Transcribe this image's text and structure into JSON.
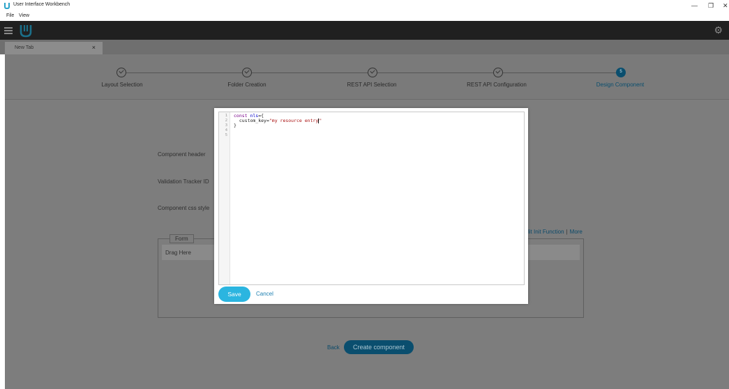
{
  "window": {
    "title": "User Interface Workbench",
    "minimize": "—",
    "restore": "❐",
    "close": "✕",
    "menu": [
      "File",
      "View"
    ]
  },
  "header": {
    "settings_icon": "gear-icon",
    "gear_glyph": "⚙"
  },
  "tabs": [
    {
      "label": "New Tab",
      "close": "×"
    }
  ],
  "stepper": {
    "steps": [
      {
        "label": "Layout Selection",
        "state": "done"
      },
      {
        "label": "Folder Creation",
        "state": "done"
      },
      {
        "label": "REST API Selection",
        "state": "done"
      },
      {
        "label": "REST API Configuration",
        "state": "done"
      },
      {
        "label": "Design Component",
        "state": "active",
        "number": "5"
      }
    ]
  },
  "form": {
    "component_header_label": "Component header",
    "validation_tracker_label": "Validation Tracker ID",
    "css_style_label": "Component css style",
    "init_function_link": "lit Init Function",
    "separator": "|",
    "more_link": "More",
    "panel_legend": "Form",
    "drag_label": "Drag Here"
  },
  "footer": {
    "back_label": "Back",
    "create_label": "Create component"
  },
  "modal": {
    "code_lines": [
      {
        "num": "1",
        "parts": [
          [
            "kw",
            "const "
          ],
          [
            "var",
            "nls"
          ],
          [
            "plain",
            "={"
          ]
        ]
      },
      {
        "num": "2",
        "parts": [
          [
            "plain",
            "  custom_key="
          ],
          [
            "str",
            "\"my resource entry"
          ],
          [
            "cursor",
            ""
          ],
          [
            "str",
            "\""
          ]
        ]
      },
      {
        "num": "3",
        "parts": [
          [
            "plain",
            "}"
          ]
        ]
      },
      {
        "num": "4",
        "parts": []
      },
      {
        "num": "5",
        "parts": []
      }
    ],
    "save_label": "Save",
    "cancel_label": "Cancel"
  },
  "colors": {
    "accent": "#2bb5e0",
    "brand": "#29a3c9",
    "active_step": "#0a4e6e"
  }
}
